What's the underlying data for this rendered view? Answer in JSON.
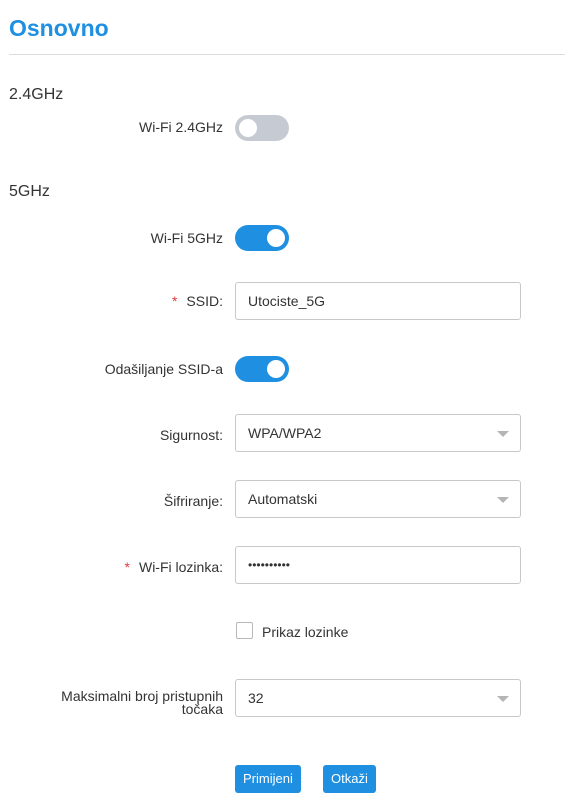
{
  "colors": {
    "accent": "#1e8fe1",
    "toggle_off": "#c6cbd3",
    "required": "#e0393e"
  },
  "header": {
    "title": "Osnovno"
  },
  "band_24": {
    "heading": "2.4GHz",
    "wifi_label": "Wi-Fi 2.4GHz",
    "wifi_enabled": false
  },
  "band_5": {
    "heading": "5GHz",
    "wifi_label": "Wi-Fi 5GHz",
    "wifi_enabled": true,
    "ssid_label": "SSID:",
    "ssid_value": "Utociste_5G",
    "broadcast_label": "Odašiljanje SSID-a",
    "broadcast_enabled": true,
    "security_label": "Sigurnost:",
    "security_value": "WPA/WPA2",
    "encryption_label": "Šifriranje:",
    "encryption_value": "Automatski",
    "password_label": "Wi-Fi lozinka:",
    "password_masked": "••••••••••",
    "show_password_label": "Prikaz lozinke",
    "show_password_checked": false,
    "max_clients_label_line1": "Maksimalni broj pristupnih",
    "max_clients_label_line2": "točaka",
    "max_clients_value": "32"
  },
  "required_mark": "*",
  "actions": {
    "apply_label": "Primijeni",
    "cancel_label": "Otkaži"
  }
}
